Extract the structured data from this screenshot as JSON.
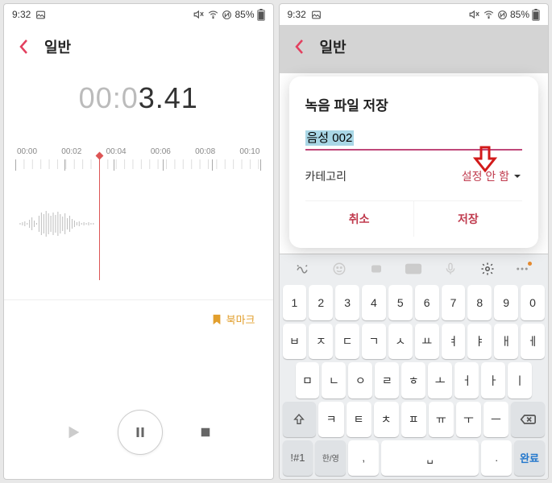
{
  "status": {
    "time": "9:32",
    "battery": "85%"
  },
  "screen1": {
    "title": "일반",
    "timer_gray": "00:0",
    "timer_dark": "3.41",
    "ruler": [
      "00:00",
      "00:02",
      "00:04",
      "00:06",
      "00:08",
      "00:10"
    ],
    "bookmark": "북마크"
  },
  "screen2": {
    "title": "일반",
    "dialog_title": "녹음 파일 저장",
    "filename": "음성 002",
    "category_label": "카테고리",
    "category_value": "설정 안 함",
    "cancel": "취소",
    "save": "저장",
    "keyboard": {
      "row1": [
        "1",
        "2",
        "3",
        "4",
        "5",
        "6",
        "7",
        "8",
        "9",
        "0"
      ],
      "row2": [
        "ㅂ",
        "ㅈ",
        "ㄷ",
        "ㄱ",
        "ㅅ",
        "ㅛ",
        "ㅕ",
        "ㅑ",
        "ㅐ",
        "ㅔ"
      ],
      "row3": [
        "ㅁ",
        "ㄴ",
        "ㅇ",
        "ㄹ",
        "ㅎ",
        "ㅗ",
        "ㅓ",
        "ㅏ",
        "ㅣ"
      ],
      "row4_mid": [
        "ㅋ",
        "ㅌ",
        "ㅊ",
        "ㅍ",
        "ㅠ",
        "ㅜ",
        "ㅡ"
      ],
      "sym": "!#1",
      "lang": "한/영",
      "comma": ",",
      "period": ".",
      "done": "완료"
    }
  }
}
